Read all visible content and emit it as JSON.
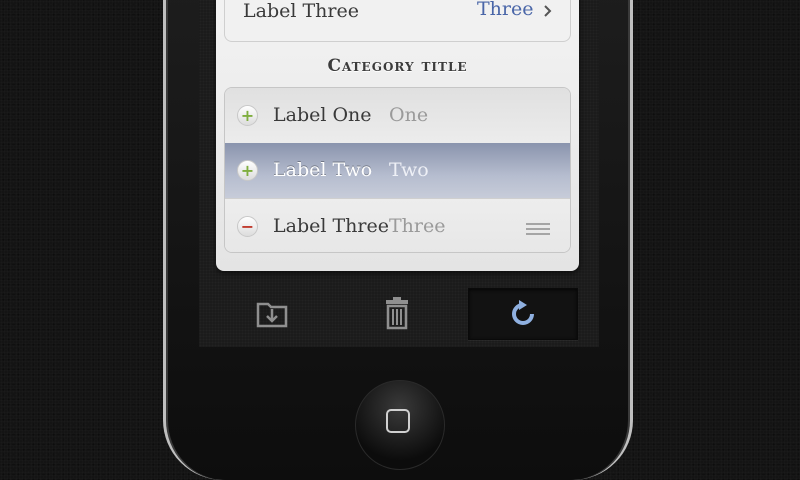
{
  "top_group": {
    "label": "Label Three",
    "value": "Three"
  },
  "category": {
    "title": "Category title"
  },
  "rows": [
    {
      "label": "Label One",
      "value": "One",
      "control": "plus"
    },
    {
      "label": "Label Two",
      "value": "Two",
      "control": "plus",
      "selected": true
    },
    {
      "label": "Label Three",
      "value": "Three",
      "control": "minus"
    }
  ],
  "toolbar": {
    "buttons": [
      {
        "icon": "folder-download-icon"
      },
      {
        "icon": "trash-icon"
      },
      {
        "icon": "refresh-icon"
      }
    ]
  },
  "colors": {
    "accent_blue": "#4a66a8",
    "selected_row": "#aeb6cb",
    "add_green": "#7fae3f",
    "delete_red": "#c0392b"
  }
}
